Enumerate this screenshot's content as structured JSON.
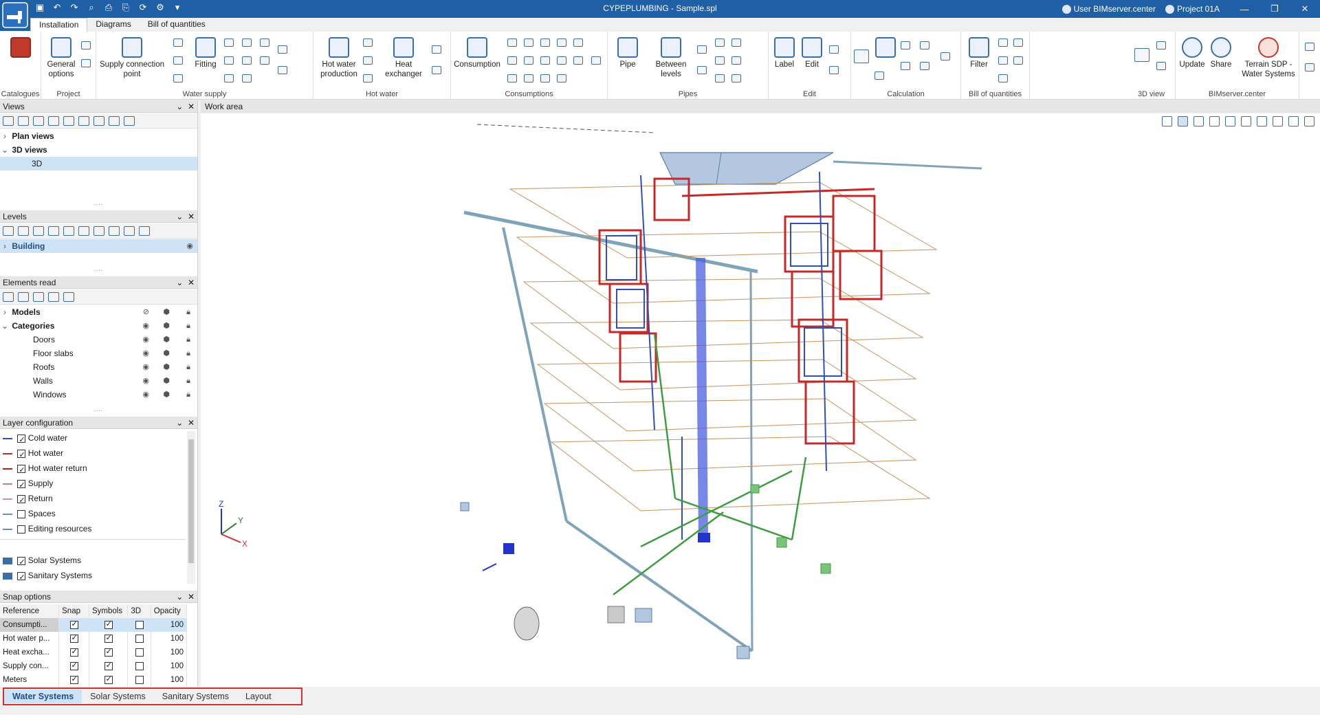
{
  "app": {
    "title": "CYPEPLUMBING - Sample.spl",
    "user": "User BIMserver.center",
    "project": "Project 01A"
  },
  "menu_tabs": [
    "Installation",
    "Diagrams",
    "Bill of quantities"
  ],
  "ribbon": {
    "groups": {
      "catalogues": "Catalogues",
      "project": "Project",
      "water_supply": "Water supply",
      "hot_water": "Hot water",
      "consumptions": "Consumptions",
      "pipes": "Pipes",
      "edit": "Edit",
      "calculation": "Calculation",
      "boq": "Bill of quantities",
      "view3d": "3D view",
      "bimserver": "BIMserver.center"
    },
    "buttons": {
      "general_options": "General options",
      "supply_connection_point": "Supply connection point",
      "fitting": "Fitting",
      "hot_water_production": "Hot water production",
      "heat_exchanger": "Heat exchanger",
      "consumption": "Consumption",
      "pipe": "Pipe",
      "between_levels": "Between levels",
      "label": "Label",
      "edit": "Edit",
      "filter": "Filter",
      "update": "Update",
      "share": "Share",
      "terrain_sdp": "Terrain SDP - Water Systems"
    }
  },
  "panels": {
    "views": {
      "title": "Views",
      "items": [
        {
          "label": "Plan views",
          "expanded": false
        },
        {
          "label": "3D views",
          "expanded": true
        },
        {
          "label": "3D",
          "selected": true
        }
      ]
    },
    "levels": {
      "title": "Levels",
      "items": [
        {
          "label": "Building"
        }
      ]
    },
    "elements_read": {
      "title": "Elements read",
      "items": [
        {
          "label": "Models",
          "level": 0
        },
        {
          "label": "Categories",
          "level": 0
        },
        {
          "label": "Doors",
          "level": 1
        },
        {
          "label": "Floor slabs",
          "level": 1
        },
        {
          "label": "Roofs",
          "level": 1
        },
        {
          "label": "Walls",
          "level": 1
        },
        {
          "label": "Windows",
          "level": 1
        }
      ]
    },
    "layers": {
      "title": "Layer configuration",
      "items": [
        {
          "label": "Cold water",
          "checked": true,
          "color": "#2f4fb5"
        },
        {
          "label": "Hot water",
          "checked": true,
          "color": "#c62828"
        },
        {
          "label": "Hot water return",
          "checked": true,
          "color": "#b71c1c"
        },
        {
          "label": "Supply",
          "checked": true,
          "color": "#b07cc6"
        },
        {
          "label": "Return",
          "checked": true,
          "color": "#d48bb0"
        },
        {
          "label": "Spaces",
          "checked": false,
          "color": "#6a8fc0"
        },
        {
          "label": "Editing resources",
          "checked": false,
          "color": "#6a8fc0"
        },
        {
          "label": "Solar Systems",
          "checked": true,
          "color": "#3a6ea5"
        },
        {
          "label": "Sanitary Systems",
          "checked": true,
          "color": "#3a6ea5"
        }
      ]
    },
    "snap": {
      "title": "Snap options",
      "columns": [
        "Reference",
        "Snap",
        "Symbols",
        "3D",
        "Opacity"
      ],
      "rows": [
        {
          "ref": "Consumpti...",
          "snap": true,
          "symbols": true,
          "d3": false,
          "opacity": "100"
        },
        {
          "ref": "Hot water p...",
          "snap": true,
          "symbols": true,
          "d3": false,
          "opacity": "100"
        },
        {
          "ref": "Heat excha...",
          "snap": true,
          "symbols": true,
          "d3": false,
          "opacity": "100"
        },
        {
          "ref": "Supply con...",
          "snap": true,
          "symbols": true,
          "d3": false,
          "opacity": "100"
        },
        {
          "ref": "Meters",
          "snap": true,
          "symbols": true,
          "d3": false,
          "opacity": "100"
        }
      ]
    }
  },
  "work_area": {
    "title": "Work area",
    "axes": {
      "x": "X",
      "y": "Y",
      "z": "Z"
    }
  },
  "bottom_tabs": [
    "Water Systems",
    "Solar Systems",
    "Sanitary Systems",
    "Layout"
  ]
}
